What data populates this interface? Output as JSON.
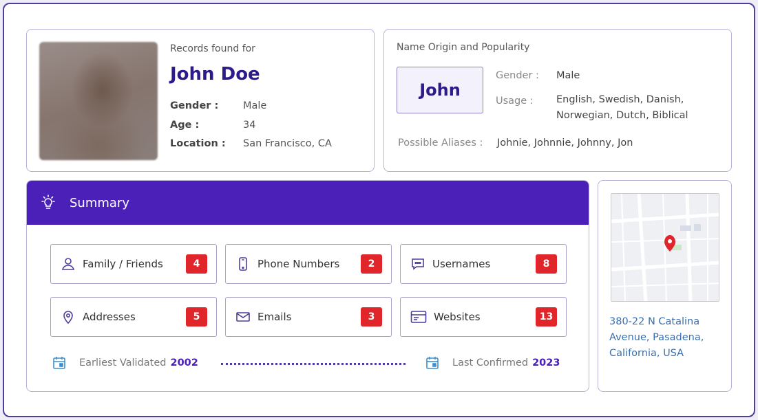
{
  "profile": {
    "records_label": "Records found for",
    "name": "John Doe",
    "fields": [
      {
        "label": "Gender :",
        "value": "Male"
      },
      {
        "label": "Age :",
        "value": "34"
      },
      {
        "label": "Location :",
        "value": "San Francisco, CA"
      }
    ]
  },
  "name_origin": {
    "title": "Name Origin and Popularity",
    "first_name": "John",
    "gender_label": "Gender :",
    "gender_value": "Male",
    "usage_label": "Usage  :",
    "usage_value": "English, Swedish, Danish, Norwegian, Dutch, Biblical",
    "aliases_label": "Possible Aliases :",
    "aliases_value": "Johnie, Johnnie, Johnny, Jon"
  },
  "summary": {
    "title": "Summary",
    "icon": "lightbulb-icon",
    "tiles": [
      {
        "label": "Family / Friends",
        "count": "4",
        "icon": "person-icon"
      },
      {
        "label": "Phone Numbers",
        "count": "2",
        "icon": "phone-icon"
      },
      {
        "label": "Usernames",
        "count": "8",
        "icon": "chat-icon"
      },
      {
        "label": "Addresses",
        "count": "5",
        "icon": "location-pin-icon"
      },
      {
        "label": "Emails",
        "count": "3",
        "icon": "mail-icon"
      },
      {
        "label": "Websites",
        "count": "13",
        "icon": "browser-icon"
      }
    ],
    "earliest_label": "Earliest Validated",
    "earliest_year": "2002",
    "last_label": "Last Confirmed",
    "last_year": "2023"
  },
  "map": {
    "address": "380-22 N Catalina Avenue, Pasadena, California, USA"
  },
  "colors": {
    "brand": "#4b20b8",
    "badge": "#e0262b",
    "name": "#2f1a8c",
    "address_link": "#3a6fb0"
  }
}
